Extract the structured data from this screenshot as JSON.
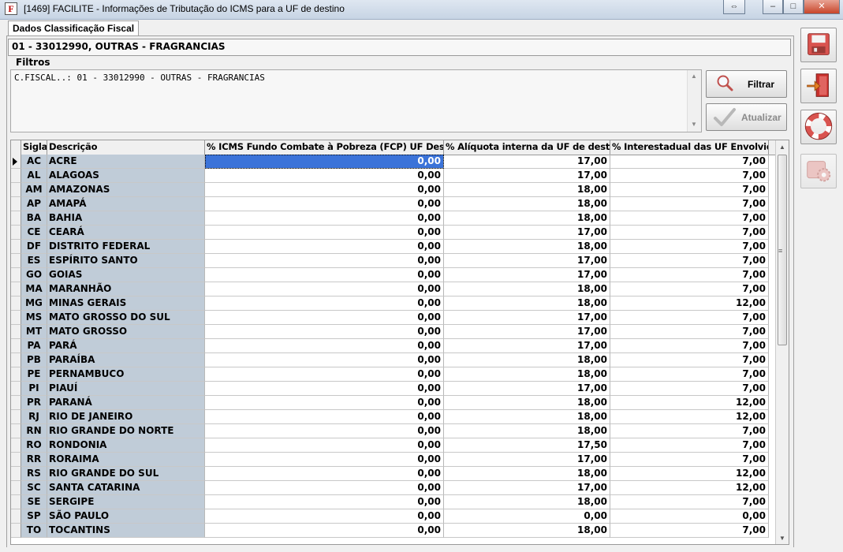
{
  "window": {
    "title": "[1469] FACILITE - Informações de Tributação do ICMS para a UF de destino",
    "icon": "F",
    "controls": {
      "restore": "⇔",
      "minimize": "–",
      "maximize": "□",
      "close": "✕"
    }
  },
  "tabs": [
    {
      "label": "Dados Classificação Fiscal",
      "active": true
    }
  ],
  "classification": {
    "value": "01 - 33012990, OUTRAS - FRAGRANCIAS"
  },
  "filters": {
    "label": "Filtros",
    "text": "C.FISCAL..: 01 - 33012990 - OUTRAS - FRAGRANCIAS",
    "filter_button": "Filtrar",
    "update_button": "Atualizar"
  },
  "grid": {
    "columns": {
      "sigla": "Sigla",
      "descricao": "Descrição",
      "fcp": "% ICMS Fundo Combate à Pobreza (FCP) UF Destino",
      "aliquota": "% Alíquota interna da UF de destino",
      "interestadual": "% Interestadual das UF Envolvidas"
    },
    "rows": [
      {
        "sigla": "AC",
        "descricao": "ACRE",
        "fcp": "0,00",
        "aliquota": "17,00",
        "interestadual": "7,00"
      },
      {
        "sigla": "AL",
        "descricao": "ALAGOAS",
        "fcp": "0,00",
        "aliquota": "17,00",
        "interestadual": "7,00"
      },
      {
        "sigla": "AM",
        "descricao": "AMAZONAS",
        "fcp": "0,00",
        "aliquota": "18,00",
        "interestadual": "7,00"
      },
      {
        "sigla": "AP",
        "descricao": "AMAPÁ",
        "fcp": "0,00",
        "aliquota": "18,00",
        "interestadual": "7,00"
      },
      {
        "sigla": "BA",
        "descricao": "BAHIA",
        "fcp": "0,00",
        "aliquota": "18,00",
        "interestadual": "7,00"
      },
      {
        "sigla": "CE",
        "descricao": "CEARÁ",
        "fcp": "0,00",
        "aliquota": "17,00",
        "interestadual": "7,00"
      },
      {
        "sigla": "DF",
        "descricao": "DISTRITO FEDERAL",
        "fcp": "0,00",
        "aliquota": "18,00",
        "interestadual": "7,00"
      },
      {
        "sigla": "ES",
        "descricao": "ESPÍRITO SANTO",
        "fcp": "0,00",
        "aliquota": "17,00",
        "interestadual": "7,00"
      },
      {
        "sigla": "GO",
        "descricao": "GOIAS",
        "fcp": "0,00",
        "aliquota": "17,00",
        "interestadual": "7,00"
      },
      {
        "sigla": "MA",
        "descricao": "MARANHÃO",
        "fcp": "0,00",
        "aliquota": "18,00",
        "interestadual": "7,00"
      },
      {
        "sigla": "MG",
        "descricao": "MINAS GERAIS",
        "fcp": "0,00",
        "aliquota": "18,00",
        "interestadual": "12,00"
      },
      {
        "sigla": "MS",
        "descricao": "MATO GROSSO DO SUL",
        "fcp": "0,00",
        "aliquota": "17,00",
        "interestadual": "7,00"
      },
      {
        "sigla": "MT",
        "descricao": "MATO GROSSO",
        "fcp": "0,00",
        "aliquota": "17,00",
        "interestadual": "7,00"
      },
      {
        "sigla": "PA",
        "descricao": "PARÁ",
        "fcp": "0,00",
        "aliquota": "17,00",
        "interestadual": "7,00"
      },
      {
        "sigla": "PB",
        "descricao": "PARAÍBA",
        "fcp": "0,00",
        "aliquota": "18,00",
        "interestadual": "7,00"
      },
      {
        "sigla": "PE",
        "descricao": "PERNAMBUCO",
        "fcp": "0,00",
        "aliquota": "18,00",
        "interestadual": "7,00"
      },
      {
        "sigla": "PI",
        "descricao": "PIAUÍ",
        "fcp": "0,00",
        "aliquota": "17,00",
        "interestadual": "7,00"
      },
      {
        "sigla": "PR",
        "descricao": "PARANÁ",
        "fcp": "0,00",
        "aliquota": "18,00",
        "interestadual": "12,00"
      },
      {
        "sigla": "RJ",
        "descricao": "RIO DE JANEIRO",
        "fcp": "0,00",
        "aliquota": "18,00",
        "interestadual": "12,00"
      },
      {
        "sigla": "RN",
        "descricao": "RIO GRANDE DO NORTE",
        "fcp": "0,00",
        "aliquota": "18,00",
        "interestadual": "7,00"
      },
      {
        "sigla": "RO",
        "descricao": "RONDONIA",
        "fcp": "0,00",
        "aliquota": "17,50",
        "interestadual": "7,00"
      },
      {
        "sigla": "RR",
        "descricao": "RORAIMA",
        "fcp": "0,00",
        "aliquota": "17,00",
        "interestadual": "7,00"
      },
      {
        "sigla": "RS",
        "descricao": "RIO GRANDE DO SUL",
        "fcp": "0,00",
        "aliquota": "18,00",
        "interestadual": "12,00"
      },
      {
        "sigla": "SC",
        "descricao": "SANTA CATARINA",
        "fcp": "0,00",
        "aliquota": "17,00",
        "interestadual": "12,00"
      },
      {
        "sigla": "SE",
        "descricao": "SERGIPE",
        "fcp": "0,00",
        "aliquota": "18,00",
        "interestadual": "7,00"
      },
      {
        "sigla": "SP",
        "descricao": "SÃO PAULO",
        "fcp": "0,00",
        "aliquota": "0,00",
        "interestadual": "0,00"
      },
      {
        "sigla": "TO",
        "descricao": "TOCANTINS",
        "fcp": "0,00",
        "aliquota": "18,00",
        "interestadual": "7,00"
      }
    ],
    "selected_row": 0
  },
  "side_toolbar": [
    {
      "icon": "save-icon",
      "enabled": true
    },
    {
      "icon": "exit-door-icon",
      "enabled": true
    },
    {
      "icon": "lifebuoy-help-icon",
      "enabled": true
    },
    {
      "icon": "settings-gear-icon",
      "enabled": false
    }
  ],
  "colors": {
    "selection": "#3b73d9",
    "fixed_column": "#c0ccd8",
    "accent_red": "#c8452a"
  }
}
